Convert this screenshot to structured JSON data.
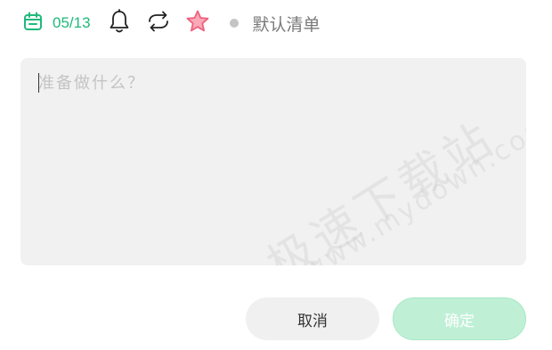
{
  "toolbar": {
    "date": "05/13",
    "list_name": "默认清单",
    "icons": [
      "calendar-icon",
      "bell-icon",
      "repeat-icon",
      "star-icon"
    ]
  },
  "input": {
    "placeholder": "准备做什么？",
    "value": ""
  },
  "watermark": {
    "main": "极速下载站",
    "sub": "www.mydown.com"
  },
  "buttons": {
    "cancel": "取消",
    "confirm": "确定"
  },
  "colors": {
    "accent": "#1fb97a",
    "star": "#f0607c",
    "confirm_bg": "#bff0d6",
    "input_bg": "#f1f1f1"
  }
}
